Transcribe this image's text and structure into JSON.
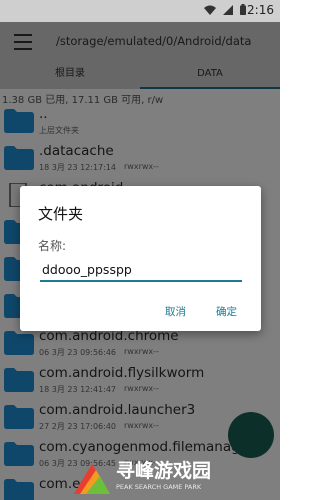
{
  "status_bar": {
    "time": "2:16",
    "icons": [
      "wifi-icon",
      "signal-icon",
      "battery-icon"
    ]
  },
  "toolbar": {
    "path": "/storage/emulated/0/Android/data",
    "menu_icon": "menu-icon"
  },
  "tabs": [
    {
      "label": "根目录",
      "selected": false
    },
    {
      "label": "DATA",
      "selected": true
    }
  ],
  "storage_info": "1.38 GB 已用, 17.11 GB 可用, r/w",
  "files": [
    {
      "name": "..",
      "date": "上层文件夹",
      "perm": ""
    },
    {
      "name": ".datacache",
      "date": "18 3月 23 12:17:14",
      "perm": "rwxrwx--"
    },
    {
      "name": "com.android.",
      "date": "",
      "perm": ""
    },
    {
      "name": "",
      "date": "",
      "perm": ""
    },
    {
      "name": "",
      "date": "",
      "perm": ""
    },
    {
      "name": "",
      "date": "",
      "perm": ""
    },
    {
      "name": "com.android.chrome",
      "date": "06 3月 23 09:56:46",
      "perm": "rwxrwx--"
    },
    {
      "name": "com.android.flysilkworm",
      "date": "18 3月 23 12:41:47",
      "perm": "rwxrwx--"
    },
    {
      "name": "com.android.launcher3",
      "date": "27 2月 23 17:06:40",
      "perm": "rwxrwx--"
    },
    {
      "name": "com.cyanogenmod.filemanager",
      "date": "06 3月 23 09:56:45",
      "perm": "rwxrwx--"
    },
    {
      "name": "com.es",
      "date": "",
      "perm": ""
    }
  ],
  "dialog": {
    "title": "文件夹",
    "label": "名称:",
    "value": "ddooo_ppsspp",
    "cancel": "取消",
    "ok": "确定",
    "accent": "#1a7b93"
  },
  "watermark": {
    "title": "寻峰游戏园",
    "subtitle": "PEAK SEARCH GAME PARK"
  },
  "colors": {
    "appbar": "#cfcfcf",
    "folder": "#1f8fd6",
    "accent": "#1a6e8e"
  }
}
